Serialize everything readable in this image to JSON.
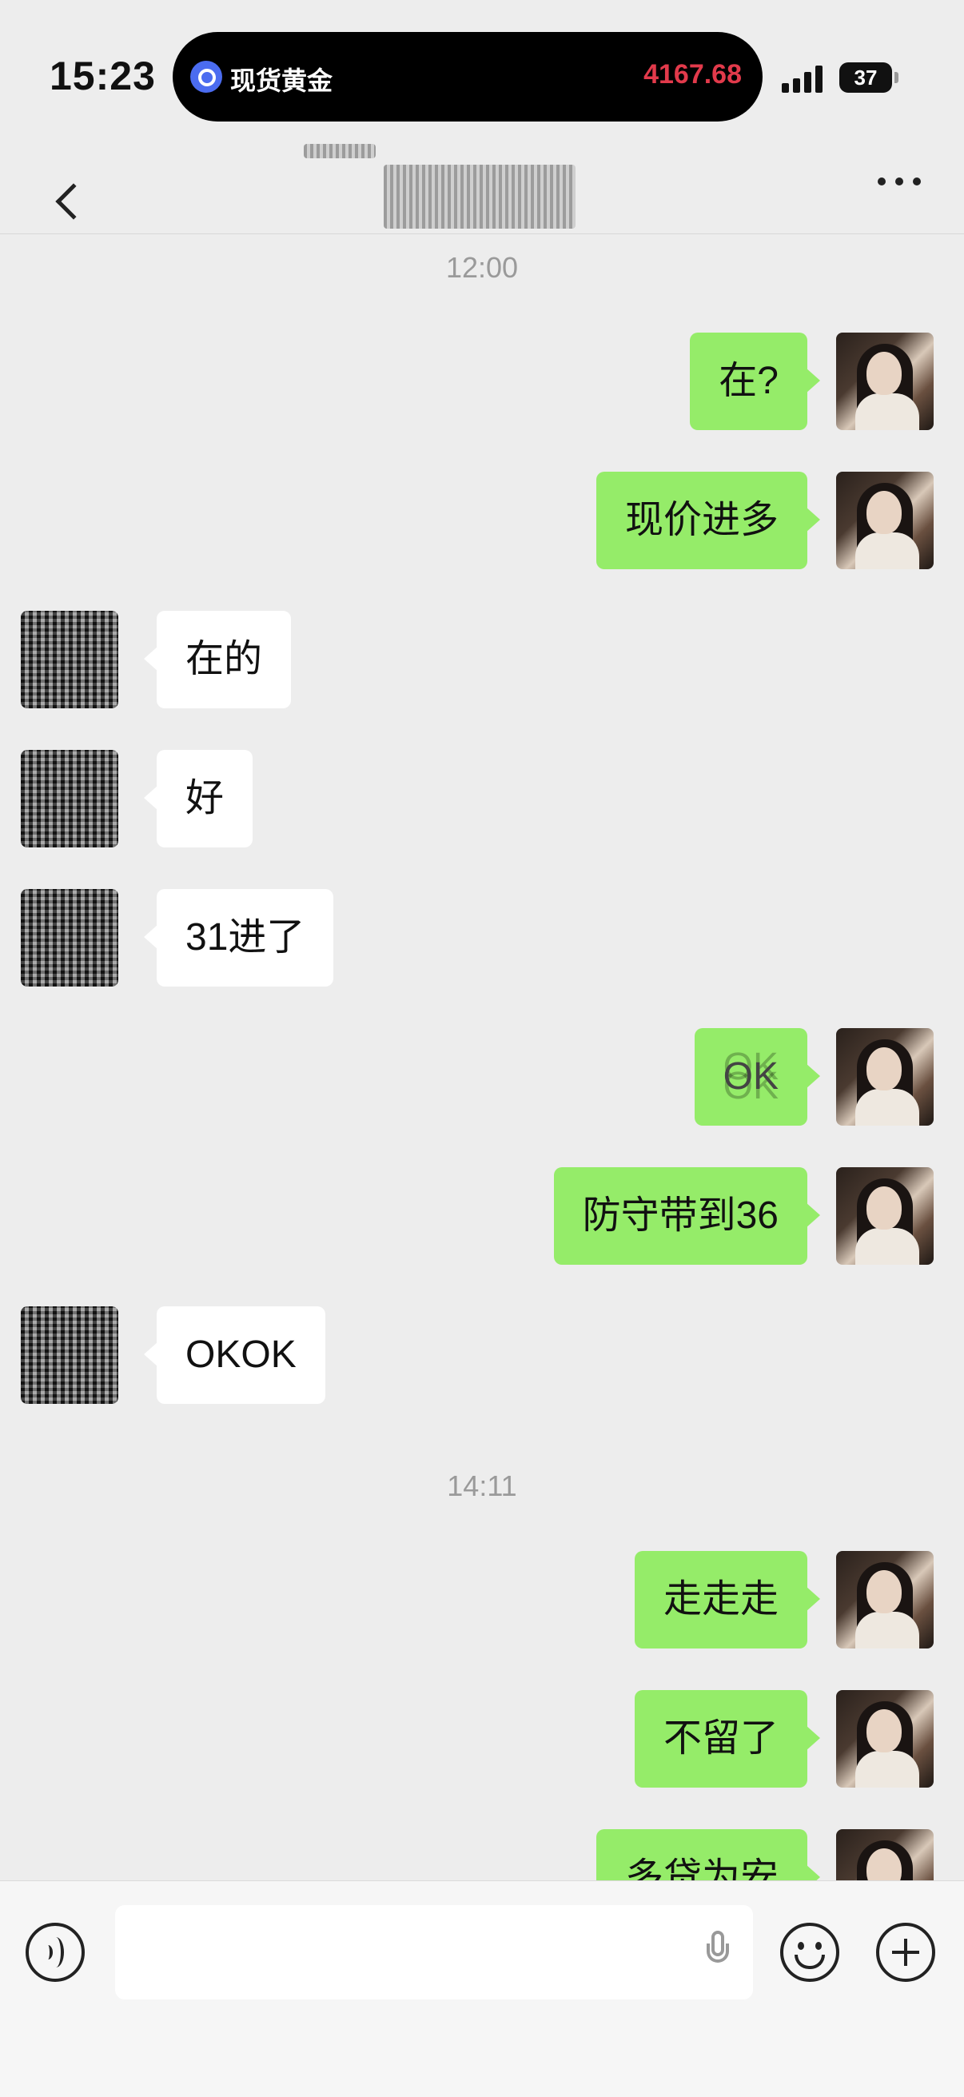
{
  "status_bar": {
    "time": "15:23",
    "live_activity": {
      "title": "现货黄金",
      "price": "4167.68"
    },
    "battery": "37"
  },
  "chat": {
    "timestamps": [
      "12:00",
      "14:11"
    ],
    "messages": [
      {
        "sender": "self",
        "text": "在?"
      },
      {
        "sender": "self",
        "text": "现价进多"
      },
      {
        "sender": "other",
        "text": "在的"
      },
      {
        "sender": "other",
        "text": "好"
      },
      {
        "sender": "other",
        "text": "31进了"
      },
      {
        "sender": "self",
        "text": "OK"
      },
      {
        "sender": "self",
        "text": "防守带到36"
      },
      {
        "sender": "other",
        "text": "OKOK"
      },
      {
        "sender": "self",
        "text": "走走走"
      },
      {
        "sender": "self",
        "text": "不留了"
      },
      {
        "sender": "self",
        "text": "多贷为安"
      }
    ]
  }
}
